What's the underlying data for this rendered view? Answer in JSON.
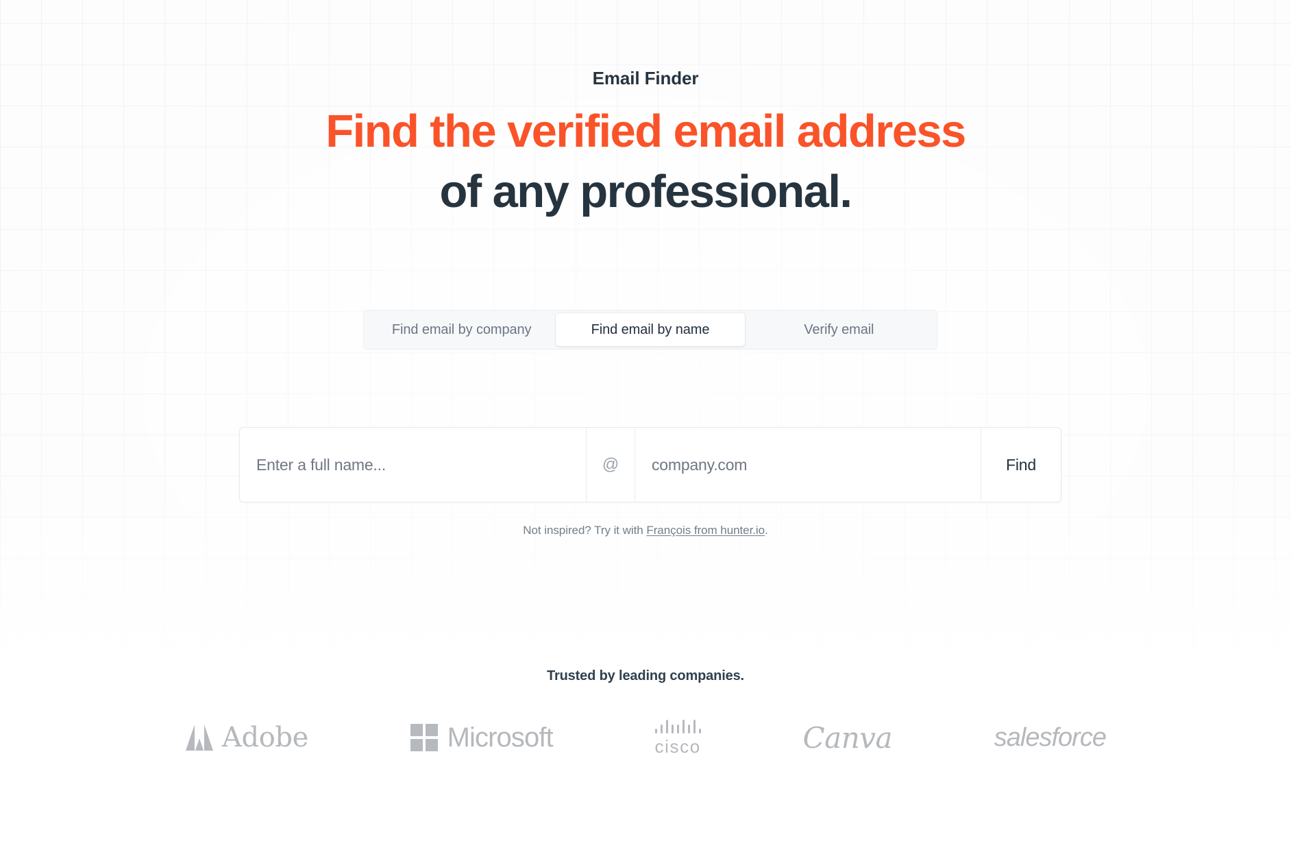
{
  "hero": {
    "eyebrow": "Email Finder",
    "headline_accent": "Find the verified email address",
    "headline_plain": "of any professional."
  },
  "tabs": {
    "items": [
      {
        "label": "Find email by company",
        "active": false
      },
      {
        "label": "Find email by name",
        "active": true
      },
      {
        "label": "Verify email",
        "active": false
      }
    ]
  },
  "search": {
    "name_placeholder": "Enter a full name...",
    "name_value": "",
    "at_symbol": "@",
    "domain_placeholder": "company.com",
    "domain_value": "",
    "submit_label": "Find"
  },
  "hint": {
    "prefix": "Not inspired? Try it with ",
    "link_text": "François from hunter.io",
    "suffix": "."
  },
  "trusted": {
    "title": "Trusted by leading companies.",
    "logos": [
      {
        "name": "Adobe",
        "word": "Adobe",
        "icon": "adobe-logo-icon"
      },
      {
        "name": "Microsoft",
        "word": "Microsoft",
        "icon": "microsoft-logo-icon"
      },
      {
        "name": "Cisco",
        "word": "cisco",
        "icon": "cisco-logo-icon"
      },
      {
        "name": "Canva",
        "word": "Canva",
        "icon": "canva-logo-icon"
      },
      {
        "name": "Salesforce",
        "word": "salesforce",
        "icon": "salesforce-logo-icon"
      }
    ]
  },
  "colors": {
    "accent": "#fa5329",
    "heading": "#26343f",
    "muted": "#6b7683",
    "logo_gray": "#b6b9bd",
    "grid_line": "#f1f2f5",
    "page_bg": "#fdfdfe"
  }
}
